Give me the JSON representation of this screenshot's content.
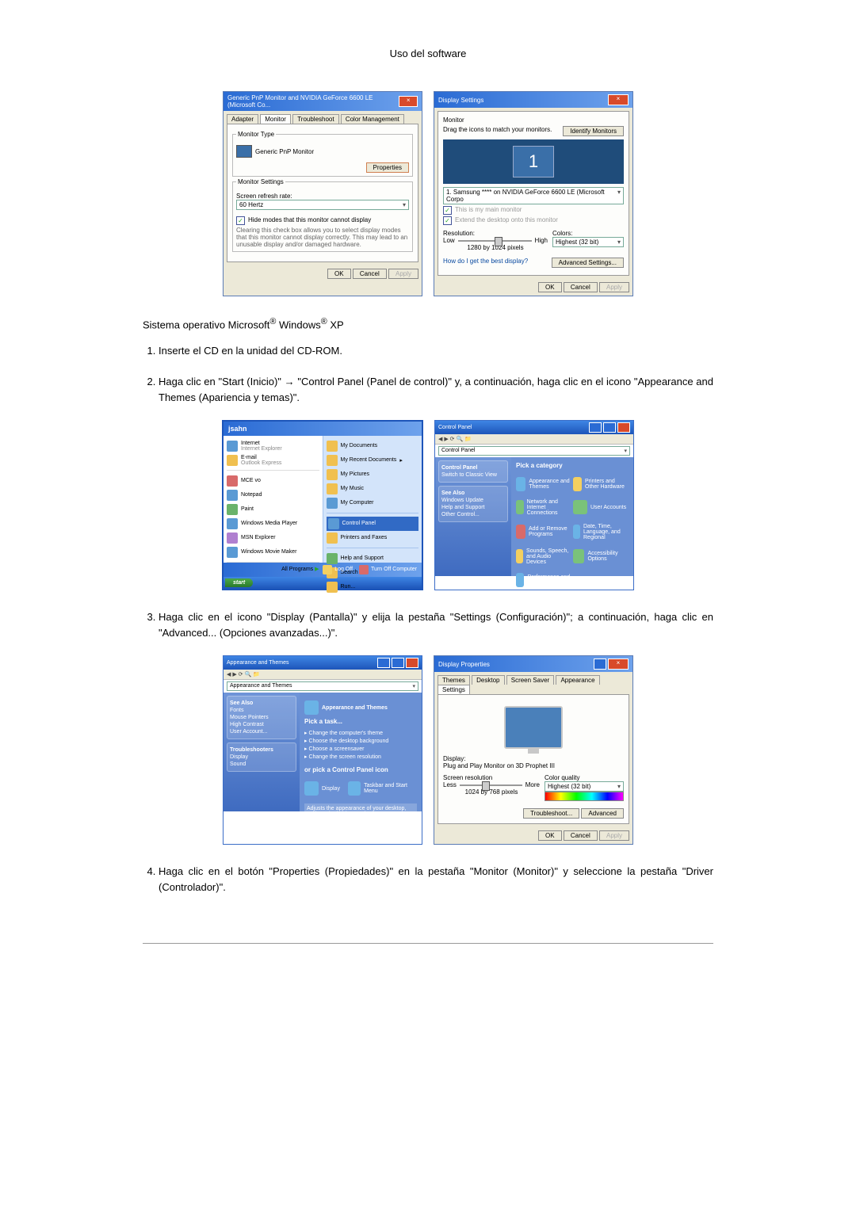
{
  "page_header": "Uso del software",
  "sys_os_line_prefix": "Sistema operativo Microsoft",
  "sys_os_line_mid": " Windows",
  "sys_os_line_suffix": " XP",
  "steps": [
    "Inserte el CD en la unidad del CD-ROM.",
    "Haga clic en \"Start (Inicio)\" → \"Control Panel (Panel de control)\" y, a continuación, haga clic en el icono \"Appearance and Themes (Apariencia y temas)\".",
    "Haga clic en el icono \"Display (Pantalla)\" y elija la pestaña \"Settings (Configuración)\"; a continuación, haga clic en \"Advanced... (Opciones avanzadas...)\".",
    "Haga clic en el botón \"Properties (Propiedades)\" en la pestaña \"Monitor (Monitor)\" y seleccione la pestaña \"Driver (Controlador)\"."
  ],
  "dialog1": {
    "title": "Generic PnP Monitor and NVIDIA GeForce 6600 LE (Microsoft Co...",
    "tabs": [
      "Adapter",
      "Monitor",
      "Troubleshoot",
      "Color Management"
    ],
    "active_tab": "Monitor",
    "monitor_type_label": "Monitor Type",
    "monitor_type_value": "Generic PnP Monitor",
    "properties_btn": "Properties",
    "monitor_settings_label": "Monitor Settings",
    "refresh_label": "Screen refresh rate:",
    "refresh_value": "60 Hertz",
    "hide_modes_checked": true,
    "hide_modes_text": "Hide modes that this monitor cannot display",
    "hide_modes_desc": "Clearing this check box allows you to select display modes that this monitor cannot display correctly. This may lead to an unusable display and/or damaged hardware.",
    "ok": "OK",
    "cancel": "Cancel",
    "apply": "Apply"
  },
  "dialog2": {
    "title": "Display Settings",
    "monitor_label": "Monitor",
    "drag_text": "Drag the icons to match your monitors.",
    "identify_btn": "Identify Monitors",
    "monitor_number": "1",
    "display_dropdown": "1. Samsung **** on NVIDIA GeForce 6600 LE (Microsoft Corpo",
    "this_main": "This is my main monitor",
    "extend": "Extend the desktop onto this monitor",
    "resolution_label": "Resolution:",
    "low": "Low",
    "high": "High",
    "resolution_value": "1280 by 1024 pixels",
    "colors_label": "Colors:",
    "colors_value": "Highest (32 bit)",
    "help_link": "How do I get the best display?",
    "advanced_btn": "Advanced Settings...",
    "ok": "OK",
    "cancel": "Cancel",
    "apply": "Apply"
  },
  "start_menu": {
    "user": "jsahn",
    "left": [
      {
        "name": "Internet",
        "sub": "Internet Explorer"
      },
      {
        "name": "E-mail",
        "sub": "Outlook Express"
      },
      {
        "name": "MCE vo"
      },
      {
        "name": "Notepad"
      },
      {
        "name": "Paint"
      },
      {
        "name": "Windows Media Player"
      },
      {
        "name": "MSN Explorer"
      },
      {
        "name": "Windows Movie Maker"
      }
    ],
    "all_programs": "All Programs",
    "right": [
      {
        "name": "My Documents"
      },
      {
        "name": "My Recent Documents",
        "arrow": true
      },
      {
        "name": "My Pictures"
      },
      {
        "name": "My Music"
      },
      {
        "name": "My Computer"
      },
      {
        "name": "Control Panel",
        "selected": true
      },
      {
        "name": "Printers and Faxes"
      },
      {
        "name": "Help and Support"
      },
      {
        "name": "Search"
      },
      {
        "name": "Run..."
      }
    ],
    "logoff": "Log Off",
    "turnoff": "Turn Off Computer",
    "start": "start"
  },
  "control_panel": {
    "title": "Control Panel",
    "addr": "Control Panel",
    "category": "Pick a category",
    "side": {
      "switch": "Switch to Classic View",
      "see_also": "See Also",
      "items": [
        "Windows Update",
        "Help and Support",
        "Other Control..."
      ]
    },
    "items": [
      "Appearance and Themes",
      "Printers and Other Hardware",
      "Network and Internet Connections",
      "User Accounts",
      "Add or Remove Programs",
      "Date, Time, Language, and Regional",
      "Sounds, Speech, and Audio Devices",
      "Accessibility Options",
      "Performance and Maintenance"
    ]
  },
  "appearance": {
    "title": "Appearance and Themes",
    "addr": "Appearance and Themes",
    "pick_task": "Pick a task...",
    "tasks": [
      "Change the computer's theme",
      "Choose the desktop background",
      "Choose a screensaver",
      "Change the screen resolution"
    ],
    "or_pick": "or pick a Control Panel icon",
    "icons": [
      "Display",
      "Taskbar and Start Menu"
    ],
    "side": {
      "see_also": "See Also",
      "items": [
        "Fonts",
        "Mouse Pointers",
        "High Contrast",
        "User Account..."
      ],
      "troubleshooters": "Troubleshooters",
      "titems": [
        "Display",
        "Sound"
      ]
    }
  },
  "display_props": {
    "title": "Display Properties",
    "tabs": [
      "Themes",
      "Desktop",
      "Screen Saver",
      "Appearance",
      "Settings"
    ],
    "active_tab": "Settings",
    "display_label": "Display:",
    "display_value": "Plug and Play Monitor on 3D Prophet III",
    "screen_res_label": "Screen resolution",
    "less": "Less",
    "more": "More",
    "resolution_value": "1024 by 768 pixels",
    "color_label": "Color quality",
    "color_value": "Highest (32 bit)",
    "troubleshoot": "Troubleshoot...",
    "advanced": "Advanced",
    "ok": "OK",
    "cancel": "Cancel",
    "apply": "Apply"
  }
}
